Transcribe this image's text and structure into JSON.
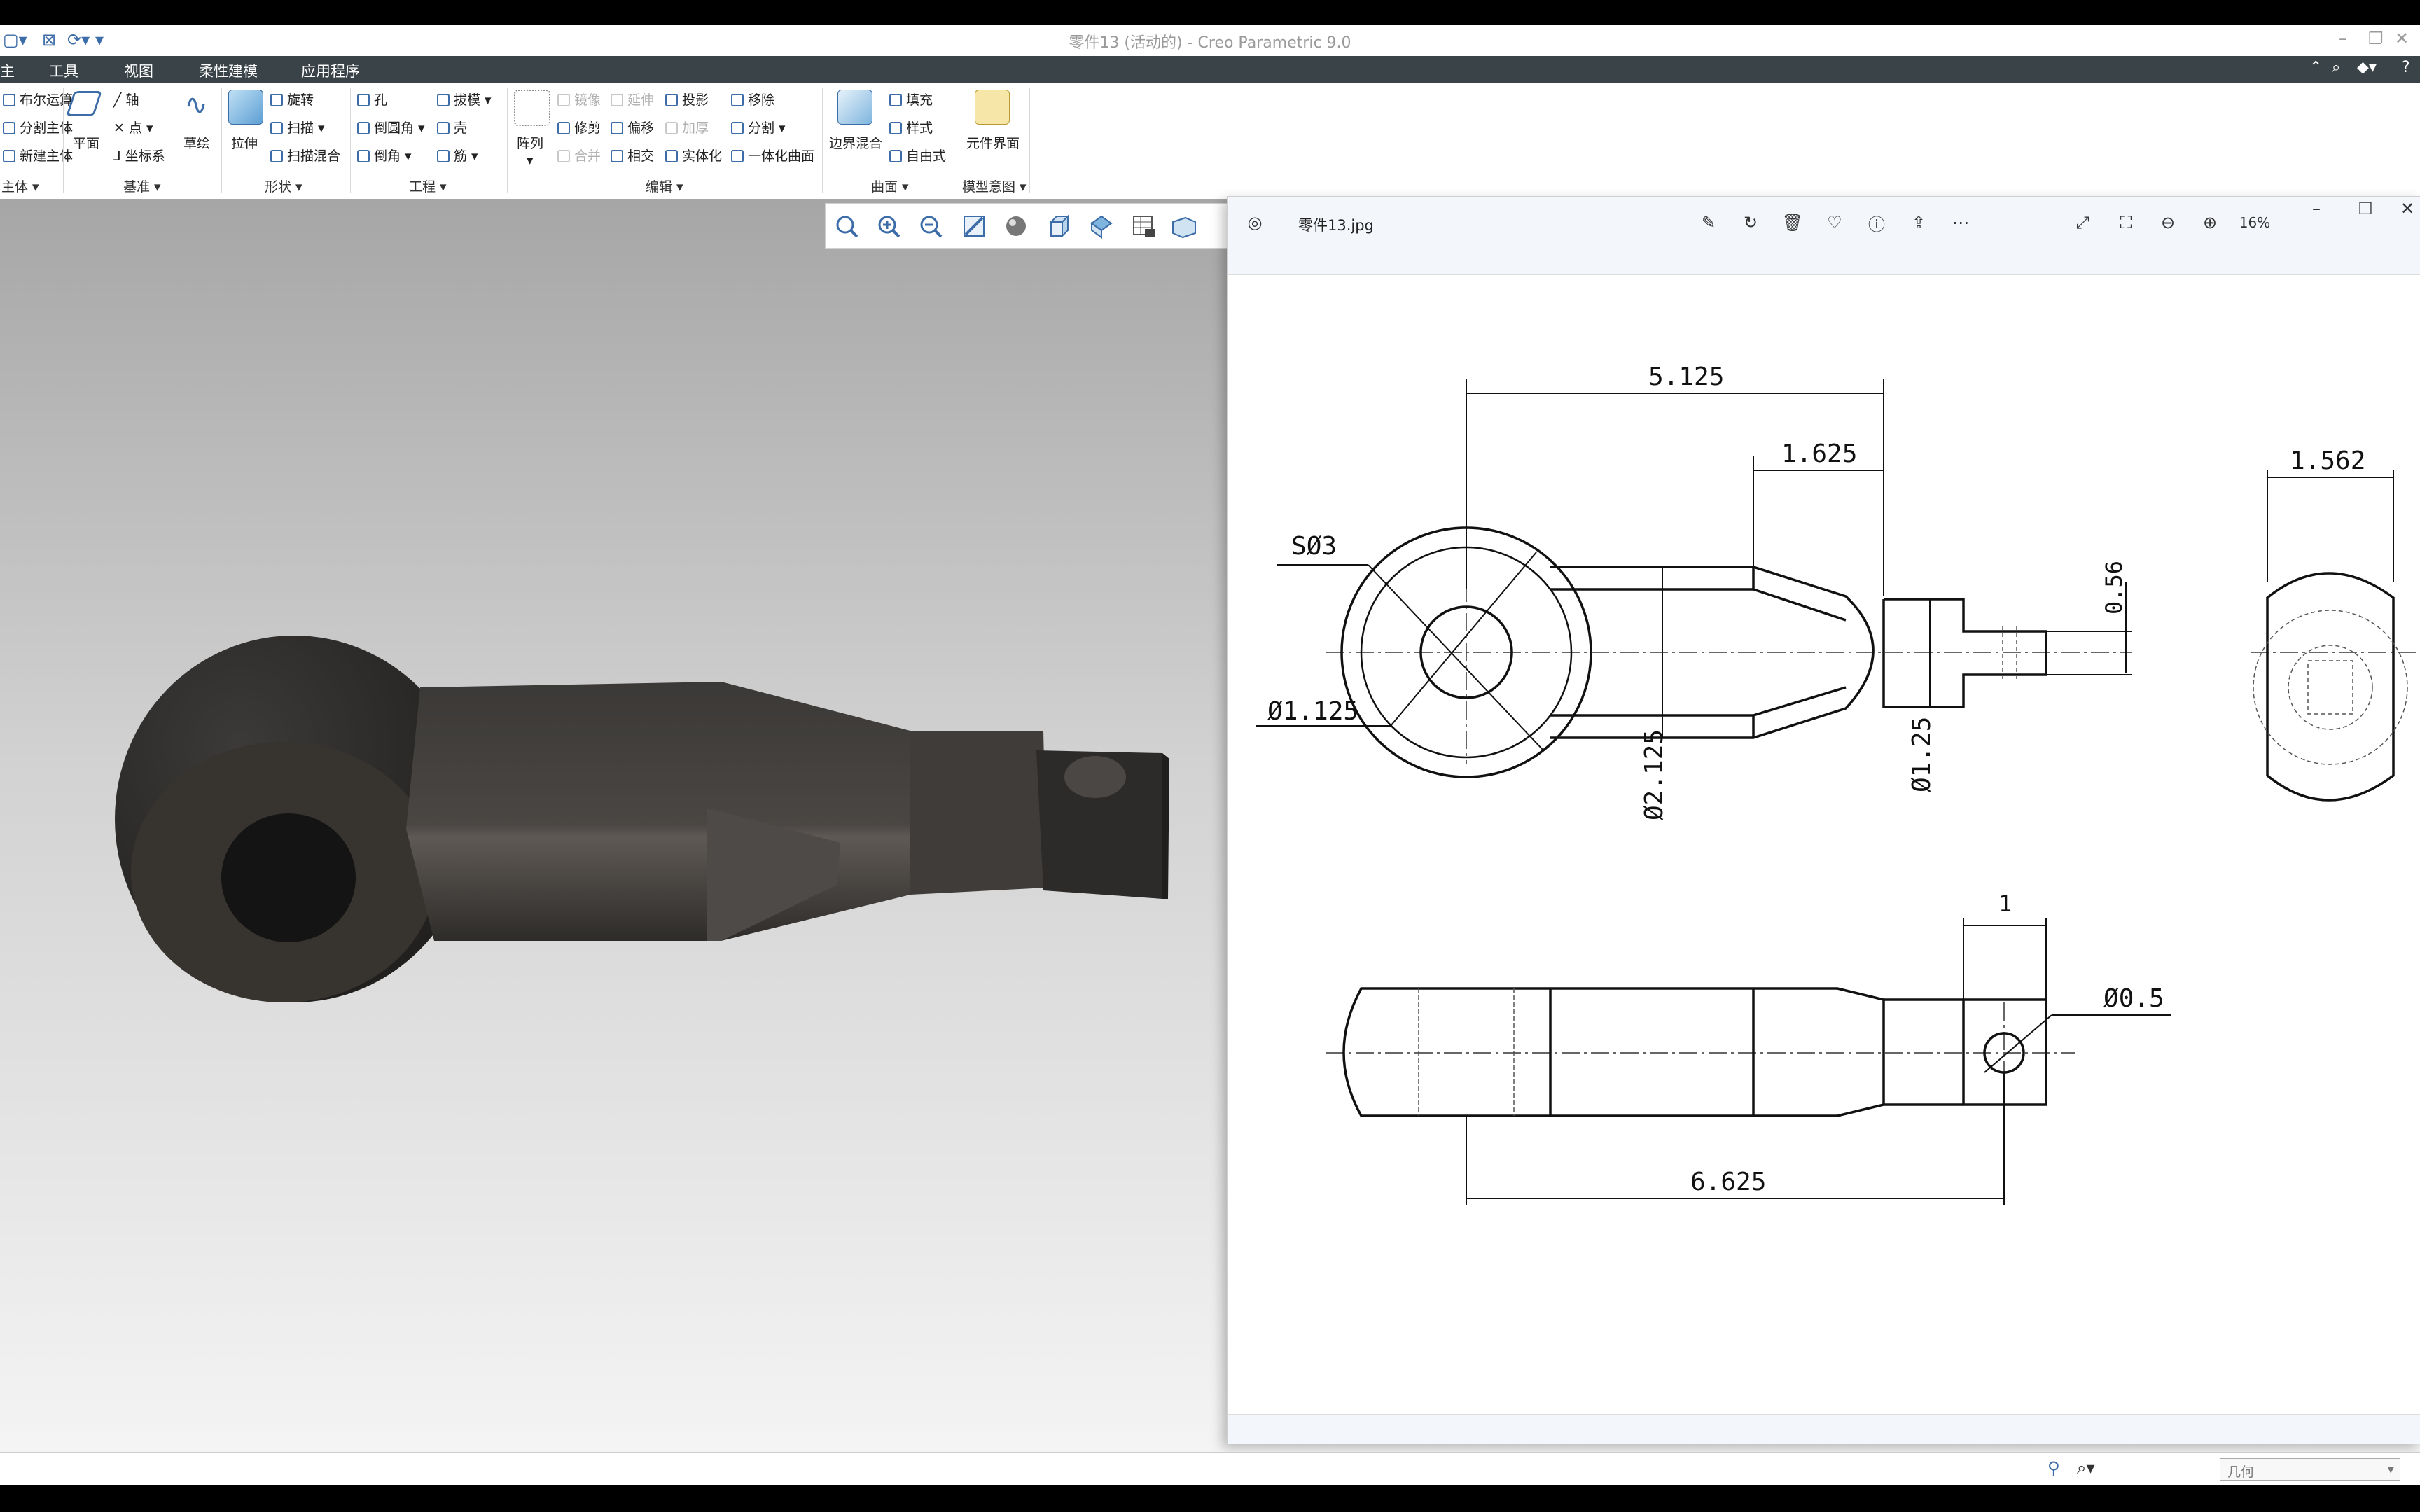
{
  "window": {
    "title": "零件13 (活动的) - Creo Parametric 9.0"
  },
  "menu": [
    "工具",
    "视图",
    "柔性建模",
    "应用程序"
  ],
  "menu_first_partial": "主",
  "ribbon": {
    "body_items": [
      "布尔运算",
      "分割主体",
      "新建主体"
    ],
    "body_group": "主体",
    "datum": {
      "plane": "平面",
      "axis": "轴",
      "point": "点",
      "csys": "坐标系",
      "sketch": "草绘",
      "group": "基准"
    },
    "shapes": {
      "extrude": "拉伸",
      "revolve": "旋转",
      "sweep": "扫描",
      "swept_blend": "扫描混合",
      "group": "形状"
    },
    "engineering": {
      "hole": "孔",
      "draft": "拔模",
      "round": "倒圆角",
      "shell": "壳",
      "chamfer": "倒角",
      "rib": "筋",
      "group": "工程"
    },
    "editing": {
      "pattern": "阵列",
      "mirror": "镜像",
      "extend": "延伸",
      "project": "投影",
      "remove": "移除",
      "trim": "修剪",
      "offset": "偏移",
      "thicken": "加厚",
      "split": "分割",
      "merge": "合并",
      "intersect": "相交",
      "solidify": "实体化",
      "unify": "一体化曲面",
      "group": "编辑"
    },
    "surfaces": {
      "boundary_blend": "边界混合",
      "fill": "填充",
      "style": "样式",
      "freestyle": "自由式",
      "group": "曲面"
    },
    "model_intent": {
      "component_interface": "元件界面",
      "group": "模型意图"
    }
  },
  "viewer": {
    "filename": "零件13.jpg",
    "zoom": "16%",
    "toolbar_icons": [
      "edit-icon",
      "rotate-icon",
      "delete-icon",
      "favorite-icon",
      "info-icon",
      "share-icon",
      "more-icon"
    ],
    "drawing": {
      "dims": [
        "5.125",
        "1.625",
        "1.562",
        "0.56",
        "1.25",
        "2.125",
        "1",
        "6.625",
        "0.5",
        "1.125",
        "3"
      ],
      "diameter_prefix": "Ø",
      "sphere_prefix": "S"
    }
  },
  "status": {
    "filter": "几何"
  }
}
